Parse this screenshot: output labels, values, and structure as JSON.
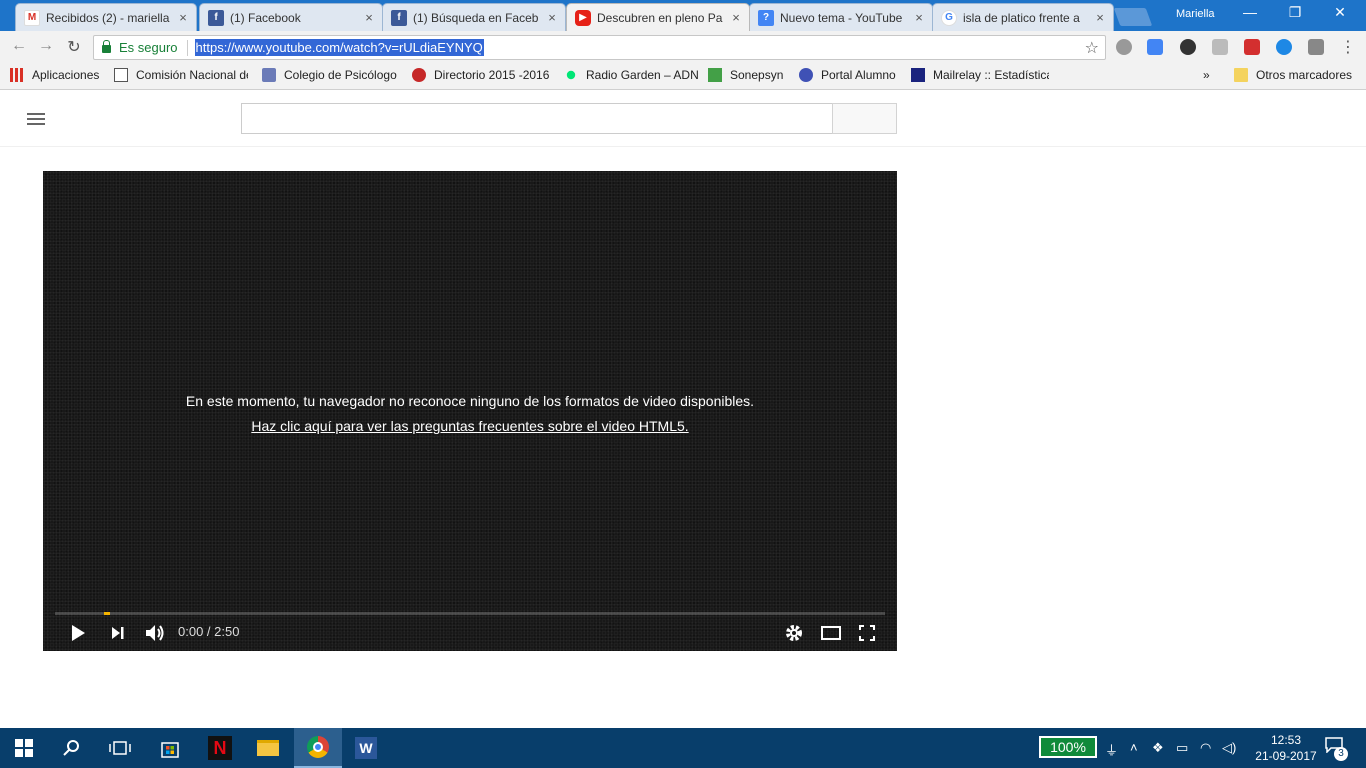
{
  "browser": {
    "tabs": [
      {
        "title": "Recibidos (2) - mariella",
        "favicon": "gmail-icon"
      },
      {
        "title": "(1) Facebook",
        "favicon": "facebook-icon"
      },
      {
        "title": "(1) Búsqueda en Faceb",
        "favicon": "facebook-icon"
      },
      {
        "title": "Descubren en pleno Pa",
        "favicon": "youtube-icon",
        "active": true
      },
      {
        "title": "Nuevo tema - YouTube",
        "favicon": "youtube-help-icon"
      },
      {
        "title": "isla de platico frente a",
        "favicon": "google-icon"
      }
    ],
    "close_glyph": "×",
    "profile_name": "Mariella",
    "window_controls": {
      "minimize": "—",
      "restore": "❐",
      "close": "✕"
    },
    "security_label": "Es seguro",
    "url": "https://www.youtube.com/watch?v=rULdiaEYNYQ",
    "bookmarks": [
      {
        "label": "Aplicaciones",
        "icon": "apps-grid-icon"
      },
      {
        "label": "Comisión Nacional de",
        "icon": "page-icon"
      },
      {
        "label": "Colegio de Psicólogo",
        "icon": "psi-logo-icon"
      },
      {
        "label": "Directorio 2015 -2016",
        "icon": "red-seal-icon"
      },
      {
        "label": "Radio Garden – ADN",
        "icon": "green-dot-icon"
      },
      {
        "label": "Sonepsyn",
        "icon": "green-doc-icon"
      },
      {
        "label": "Portal Alumno",
        "icon": "blue-circle-icon"
      },
      {
        "label": "Mailrelay :: Estadística",
        "icon": "mail-icon"
      }
    ],
    "overflow_glyph": "»",
    "other_bookmarks": "Otros marcadores"
  },
  "player": {
    "error_message": "En este momento, tu navegador no reconoce ninguno de los formatos de video disponibles.",
    "faq_link": "Haz clic aquí para ver las preguntas frecuentes sobre el video HTML5.",
    "time_display": "0:00 / 2:50",
    "buffered_fraction": 0.06
  },
  "taskbar": {
    "battery": "100%",
    "time": "12:53",
    "date": "21-09-2017",
    "notifications_count": "3"
  },
  "colors": {
    "tabstrip": "#1e74c9",
    "taskbar": "#083e6b",
    "secure": "#188038",
    "progress_buffer": "#f5b400"
  }
}
